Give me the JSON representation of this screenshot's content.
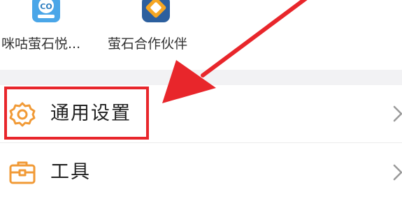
{
  "apps": [
    {
      "label": "咪咕萤石悦...",
      "icon": "migu-camera-icon"
    },
    {
      "label": "萤石合作伙伴",
      "icon": "partner-app-icon"
    }
  ],
  "menu": [
    {
      "label": "通用设置",
      "icon": "gear-icon"
    },
    {
      "label": "工具",
      "icon": "toolbox-icon"
    }
  ],
  "colors": {
    "accent_orange": "#f19a36",
    "annotation_red": "#e8262b",
    "divider_band": "#f2f2f4"
  },
  "annotation": {
    "highlighted_item": "通用设置",
    "arrow_color": "#e8262b"
  }
}
